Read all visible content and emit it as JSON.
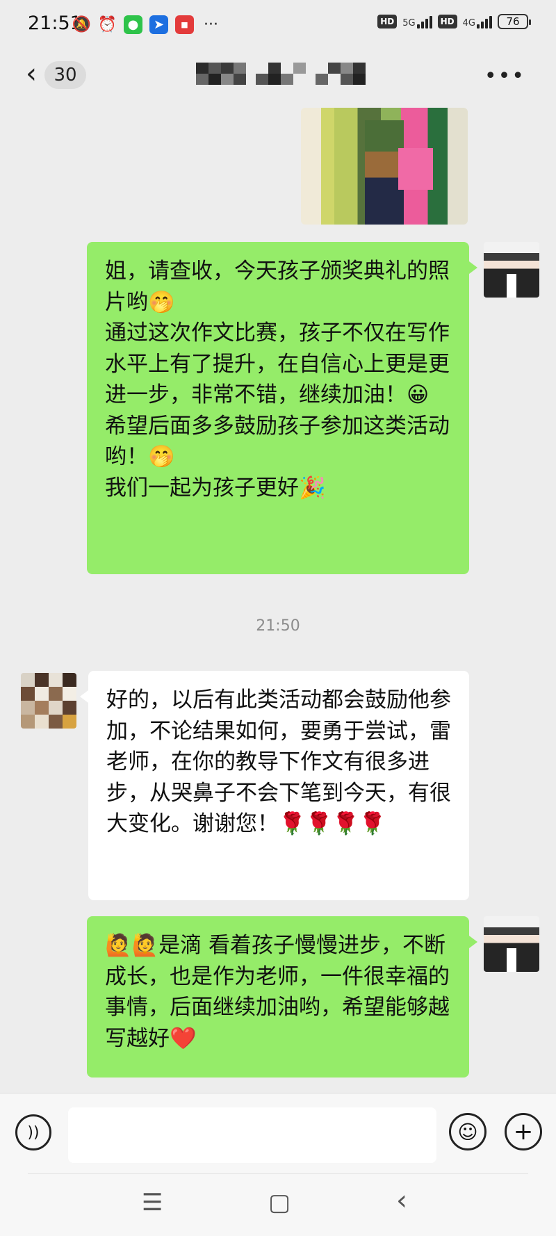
{
  "status_bar": {
    "time": "21:51",
    "network_1": "5G",
    "network_2": "4G",
    "hd_label": "HD",
    "battery": "76",
    "more": "···"
  },
  "nav": {
    "back_icon": "chevron-left",
    "unread_count": "30",
    "more_icon": "more-dots"
  },
  "messages": [
    {
      "side": "right",
      "lines": [
        "姐，请查收，今天孩子颁奖典礼的照片哟🤭",
        "通过这次作文比赛，孩子不仅在写作水平上有了提升，在自信心上更是更进一步，非常不错，继续加油！😀",
        "希望后面多多鼓励孩子参加这类活动哟！🤭",
        "我们一起为孩子更好🎉"
      ]
    },
    {
      "side": "left",
      "text": "好的，以后有此类活动都会鼓励他参加，不论结果如何，要勇于尝试，雷老师，在你的教导下作文有很多进步，从哭鼻子不会下笔到今天，有很大变化。谢谢您！🌹🌹🌹🌹"
    },
    {
      "side": "right",
      "text": "🙋🙋是滴 看着孩子慢慢进步，不断成长，也是作为老师，一件很幸福的事情，后面继续加油哟，希望能够越写越好❤️"
    }
  ],
  "timestamp": "21:50",
  "input_bar": {
    "placeholder": "",
    "voice_icon": "voice-icon",
    "emoji_icon": "emoji-icon",
    "plus_icon": "plus-icon"
  },
  "system_nav": {
    "menu": "☰",
    "home": "▢",
    "back": "‹"
  }
}
